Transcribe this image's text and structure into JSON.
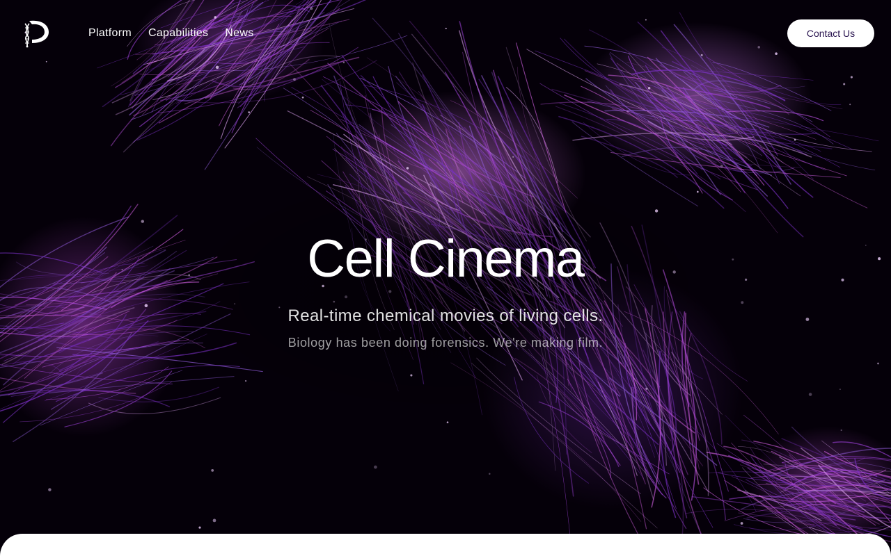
{
  "brand": {
    "logo_icon": "dna-d-logo-icon"
  },
  "nav": {
    "links": [
      {
        "label": "Platform"
      },
      {
        "label": "Capabilities"
      },
      {
        "label": "News"
      }
    ],
    "contact_label": "Contact Us"
  },
  "hero": {
    "title": "Cell Cinema",
    "subtitle": "Real-time chemical movies of living cells.",
    "tagline": "Biology has been doing forensics. We're making film.",
    "background_image": "fluorescent-cell-microscopy-image"
  },
  "colors": {
    "accent_purple": "#9b3fd6",
    "magenta": "#c85ad8",
    "background": "#050009",
    "button_text": "#2a1550"
  }
}
